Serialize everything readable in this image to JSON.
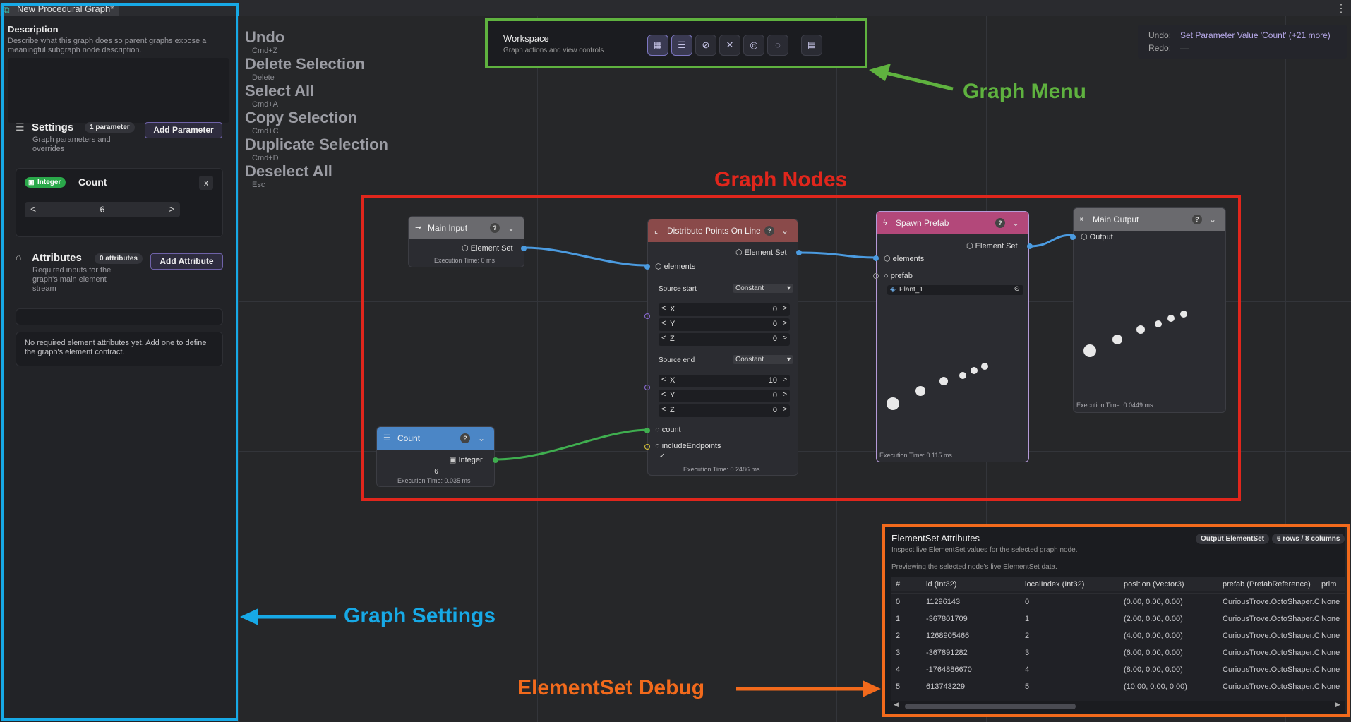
{
  "window": {
    "tab_title": "New Procedural Graph*",
    "kebab": "⋮"
  },
  "left_panel": {
    "description_label": "Description",
    "description_hint": "Describe what this graph does so parent graphs expose a meaningful subgraph node description.",
    "settings": {
      "title": "Settings",
      "badge": "1 parameter",
      "subtitle": "Graph parameters and overrides",
      "add_button": "Add Parameter"
    },
    "parameter": {
      "type_badge": "Integer",
      "name": "Count",
      "value": "6",
      "remove": "x"
    },
    "attributes": {
      "title": "Attributes",
      "badge": "0 attributes",
      "subtitle": "Required inputs for the graph's main element stream",
      "add_button": "Add Attribute",
      "empty_text": "No required element attributes yet. Add one to define the graph's element contract."
    }
  },
  "history": [
    {
      "label": "Undo",
      "key": "Cmd+Z"
    },
    {
      "label": "Delete Selection",
      "key": "Delete"
    },
    {
      "label": "Select All",
      "key": "Cmd+A"
    },
    {
      "label": "Copy Selection",
      "key": "Cmd+C"
    },
    {
      "label": "Duplicate Selection",
      "key": "Cmd+D"
    },
    {
      "label": "Deselect All",
      "key": "Esc"
    }
  ],
  "workspace": {
    "title": "Workspace",
    "subtitle": "Graph actions and view controls",
    "icons": [
      "layout-icon",
      "sliders-icon",
      "no-cursor-icon",
      "no-pin-icon",
      "target-icon",
      "eye-off-icon",
      "save-icon"
    ]
  },
  "undo_info": {
    "undo_label": "Undo:",
    "undo_value": "Set Parameter Value 'Count' (+21 more)",
    "redo_label": "Redo:",
    "redo_value": "—"
  },
  "annotations": {
    "graph_menu": "Graph Menu",
    "graph_nodes": "Graph Nodes",
    "graph_settings": "Graph Settings",
    "elementset_debug": "ElementSet Debug"
  },
  "colors": {
    "graph_menu": "#5fb23f",
    "graph_nodes": "#e0261c",
    "graph_settings": "#17a9e6",
    "elementset_debug": "#f26a1c",
    "wire_blue": "#4b9be0",
    "wire_green": "#3fae4f"
  },
  "nodes": {
    "main_input": {
      "title": "Main Input",
      "out_port": "Element Set",
      "exec": "Execution Time: 0 ms"
    },
    "count": {
      "title": "Count",
      "out_port": "Integer",
      "value": "6",
      "exec": "Execution Time: 0.035 ms"
    },
    "distribute": {
      "title": "Distribute Points On Line",
      "out_port": "Element Set",
      "in_port": "elements",
      "start_label": "Source start",
      "start_mode": "Constant",
      "start_rows": [
        {
          "axis": "X",
          "value": "0"
        },
        {
          "axis": "Y",
          "value": "0"
        },
        {
          "axis": "Z",
          "value": "0"
        }
      ],
      "end_label": "Source end",
      "end_mode": "Constant",
      "end_rows": [
        {
          "axis": "X",
          "value": "10"
        },
        {
          "axis": "Y",
          "value": "0"
        },
        {
          "axis": "Z",
          "value": "0"
        }
      ],
      "count_port": "count",
      "endpoints_port": "includeEndpoints",
      "check": "✓",
      "exec": "Execution Time: 0.2486 ms"
    },
    "spawn": {
      "title": "Spawn Prefab",
      "out_port": "Element Set",
      "in_port": "elements",
      "prefab_port": "prefab",
      "prefab_value": "Plant_1",
      "exec": "Execution Time: 0.115 ms"
    },
    "main_output": {
      "title": "Main Output",
      "in_port": "Output",
      "exec": "Execution Time: 0.0449 ms"
    }
  },
  "debug": {
    "title": "ElementSet Attributes",
    "tag": "Output ElementSet",
    "size": "6 rows / 8 columns",
    "subtitle": "Inspect live ElementSet values for the selected graph node.",
    "preview": "Previewing the selected node's live ElementSet data.",
    "columns": [
      "#",
      "id (Int32)",
      "localIndex (Int32)",
      "position (Vector3)",
      "prefab (PrefabReference)",
      "prim"
    ],
    "rows": [
      [
        "0",
        "11296143",
        "0",
        "(0.00, 0.00, 0.00)",
        "CuriousTrove.OctoShaper.C",
        "None"
      ],
      [
        "1",
        "-367801709",
        "1",
        "(2.00, 0.00, 0.00)",
        "CuriousTrove.OctoShaper.C",
        "None"
      ],
      [
        "2",
        "1268905466",
        "2",
        "(4.00, 0.00, 0.00)",
        "CuriousTrove.OctoShaper.C",
        "None"
      ],
      [
        "3",
        "-367891282",
        "3",
        "(6.00, 0.00, 0.00)",
        "CuriousTrove.OctoShaper.C",
        "None"
      ],
      [
        "4",
        "-1764886670",
        "4",
        "(8.00, 0.00, 0.00)",
        "CuriousTrove.OctoShaper.C",
        "None"
      ],
      [
        "5",
        "613743229",
        "5",
        "(10.00, 0.00, 0.00)",
        "CuriousTrove.OctoShaper.C",
        "None"
      ]
    ]
  }
}
